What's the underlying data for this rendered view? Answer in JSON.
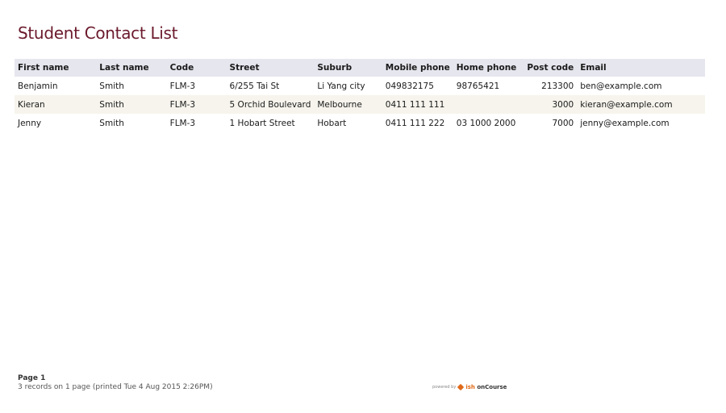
{
  "report": {
    "title": "Student Contact List"
  },
  "table": {
    "headers": {
      "first_name": "First name",
      "last_name": "Last name",
      "code": "Code",
      "street": "Street",
      "suburb": "Suburb",
      "mobile": "Mobile phone",
      "home": "Home phone",
      "postcode": "Post code",
      "email": "Email"
    },
    "rows": [
      {
        "first_name": "Benjamin",
        "last_name": "Smith",
        "code": "FLM-3",
        "street": "6/255 Tai St",
        "suburb": "Li Yang city",
        "mobile": "049832175",
        "home": "98765421",
        "postcode": "213300",
        "email": "ben@example.com"
      },
      {
        "first_name": "Kieran",
        "last_name": "Smith",
        "code": "FLM-3",
        "street": "5 Orchid Boulevard",
        "suburb": "Melbourne",
        "mobile": "0411 111 111",
        "home": "",
        "postcode": "3000",
        "email": "kieran@example.com"
      },
      {
        "first_name": "Jenny",
        "last_name": "Smith",
        "code": "FLM-3",
        "street": "1 Hobart Street",
        "suburb": "Hobart",
        "mobile": "0411 111 222",
        "home": "03 1000 2000",
        "postcode": "7000",
        "email": "jenny@example.com"
      }
    ]
  },
  "footer": {
    "page": "Page 1",
    "summary": "3 records on 1 page (printed Tue 4 Aug 2015 2:26PM)"
  },
  "powered_by": {
    "prefix": "powered by",
    "brand_part1": "ish",
    "brand_part2": "onCourse"
  },
  "colors": {
    "title": "#6b1a2c",
    "header_bg": "#e6e6ef",
    "alt_row_bg": "#f6f4ec",
    "brand_accent": "#e06a1a"
  }
}
